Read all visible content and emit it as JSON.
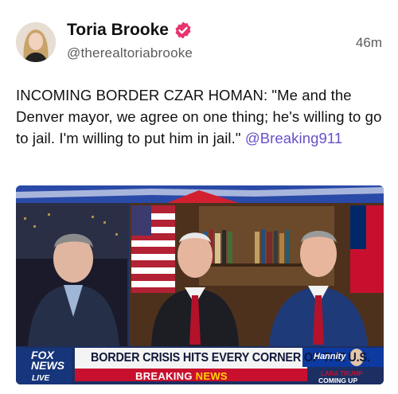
{
  "post": {
    "author_name": "Toria Brooke",
    "handle": "@therealtoriabrooke",
    "timestamp": "46m",
    "text_main": "INCOMING BORDER CZAR HOMAN: \"Me and the Denver mayor, we agree on one thing; he's willing to go to jail. I'm willing to put him in jail.\"",
    "mention": "@Breaking911",
    "verified_color": "#e8336e"
  },
  "media": {
    "network_logo_top": "FOX",
    "network_logo_bottom": "NEWS",
    "live_label": "LIVE",
    "chyron_headline": "BORDER CRISIS HITS EVERY CORNER OF THE U.S.",
    "breaking_label_1": "BREAKING",
    "breaking_label_2": "NEWS",
    "show_logo": "Hannity",
    "promo_line_1": "LARA TRUMP",
    "promo_line_2": "COMING UP"
  }
}
